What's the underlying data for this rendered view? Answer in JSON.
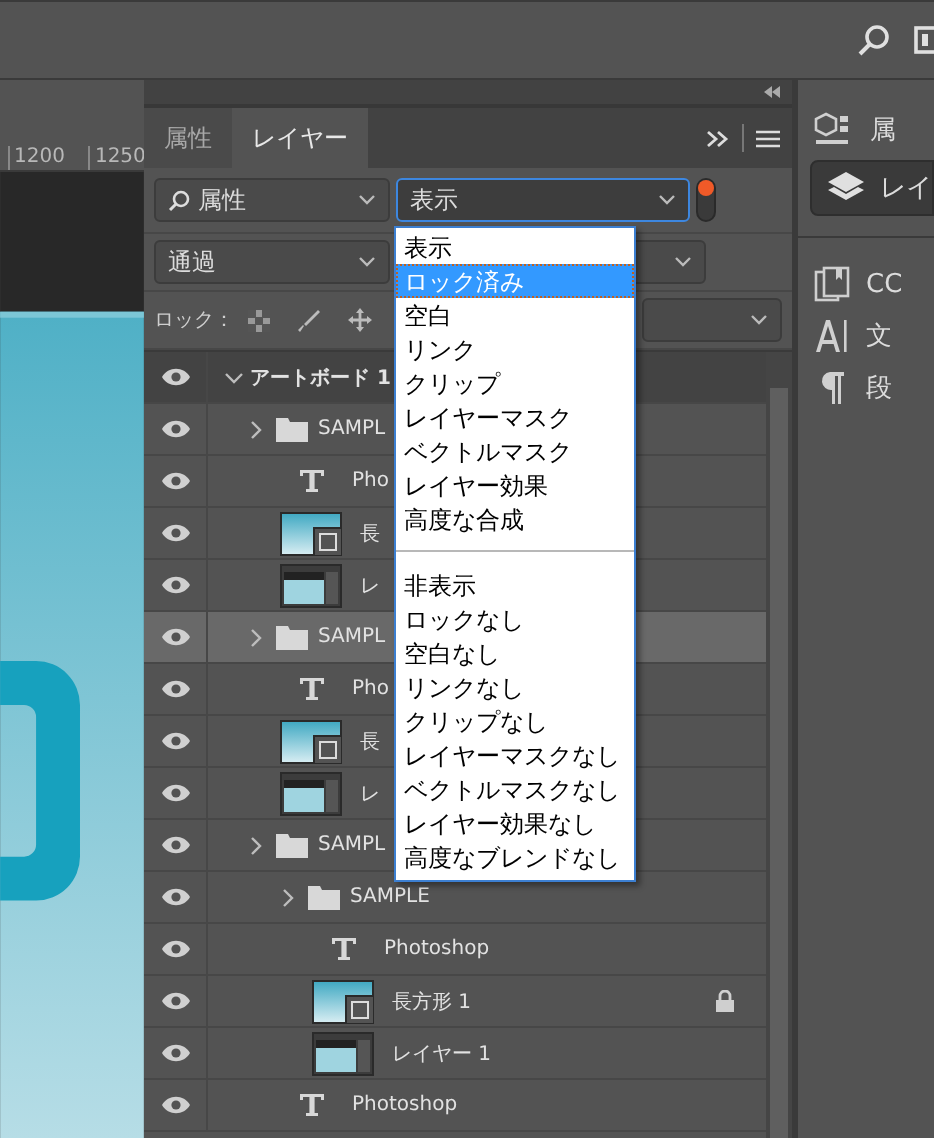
{
  "canvas": {
    "ruler_labels": [
      "1200",
      "1250"
    ]
  },
  "panel": {
    "tabs": [
      {
        "label": "属性",
        "selected": false
      },
      {
        "label": "レイヤー",
        "selected": true
      }
    ],
    "filter_type": "属性",
    "filter_value": "表示",
    "filter_on": true,
    "blend_mode": "通過",
    "lock_label": "ロック：",
    "layers": [
      {
        "kind": "artboard",
        "name": "アートボード 1",
        "expanded": true,
        "selected": false,
        "locked": false,
        "visible": true,
        "children": [
          {
            "kind": "group",
            "name": "SAMPL",
            "expanded": false,
            "selected": false,
            "locked": false,
            "visible": true,
            "children": [
              {
                "kind": "text",
                "name": "Pho",
                "selected": false,
                "locked": false,
                "visible": true
              },
              {
                "kind": "shape",
                "name": "長",
                "selected": false,
                "locked": false,
                "visible": true
              },
              {
                "kind": "pixel",
                "name": "レ",
                "selected": false,
                "locked": false,
                "visible": true
              }
            ]
          },
          {
            "kind": "group",
            "name": "SAMPL",
            "expanded": false,
            "selected": true,
            "locked": false,
            "visible": true,
            "children": [
              {
                "kind": "text",
                "name": "Pho",
                "selected": false,
                "locked": false,
                "visible": true
              },
              {
                "kind": "shape",
                "name": "長",
                "selected": false,
                "locked": false,
                "visible": true
              },
              {
                "kind": "pixel",
                "name": "レ",
                "selected": false,
                "locked": false,
                "visible": true
              }
            ]
          },
          {
            "kind": "group",
            "name": "SAMPL",
            "expanded": false,
            "selected": false,
            "locked": false,
            "visible": true,
            "children": [
              {
                "kind": "group",
                "name": "SAMPLE",
                "expanded": false,
                "selected": false,
                "locked": false,
                "visible": true,
                "children": [
                  {
                    "kind": "text",
                    "name": "Photoshop",
                    "selected": false,
                    "locked": false,
                    "visible": true
                  },
                  {
                    "kind": "shape",
                    "name": "長方形 1",
                    "selected": false,
                    "locked": true,
                    "visible": true
                  },
                  {
                    "kind": "pixel",
                    "name": "レイヤー 1",
                    "selected": false,
                    "locked": false,
                    "visible": true
                  }
                ]
              },
              {
                "kind": "text",
                "name": "Photoshop",
                "selected": false,
                "locked": false,
                "visible": true
              }
            ]
          }
        ]
      }
    ],
    "menu": [
      {
        "kind": "option",
        "label": "表示",
        "selected": false
      },
      {
        "kind": "option",
        "label": "ロック済み",
        "selected": true
      },
      {
        "kind": "option",
        "label": "空白",
        "selected": false
      },
      {
        "kind": "option",
        "label": "リンク",
        "selected": false
      },
      {
        "kind": "option",
        "label": "クリップ",
        "selected": false
      },
      {
        "kind": "option",
        "label": "レイヤーマスク",
        "selected": false
      },
      {
        "kind": "option",
        "label": "ベクトルマスク",
        "selected": false
      },
      {
        "kind": "option",
        "label": "レイヤー効果",
        "selected": false
      },
      {
        "kind": "option",
        "label": "高度な合成",
        "selected": false
      },
      {
        "kind": "separator"
      },
      {
        "kind": "option",
        "label": "非表示",
        "selected": false
      },
      {
        "kind": "option",
        "label": "ロックなし",
        "selected": false
      },
      {
        "kind": "option",
        "label": "空白なし",
        "selected": false
      },
      {
        "kind": "option",
        "label": "リンクなし",
        "selected": false
      },
      {
        "kind": "option",
        "label": "クリップなし",
        "selected": false
      },
      {
        "kind": "option",
        "label": "レイヤーマスクなし",
        "selected": false
      },
      {
        "kind": "option",
        "label": "ベクトルマスクなし",
        "selected": false
      },
      {
        "kind": "option",
        "label": "レイヤー効果なし",
        "selected": false
      },
      {
        "kind": "option",
        "label": "高度なブレンドなし",
        "selected": false
      }
    ]
  },
  "dock": {
    "items": [
      {
        "kind": "properties",
        "label": "属",
        "selected": false
      },
      {
        "kind": "layers",
        "label": "レイ",
        "selected": true
      },
      {
        "kind": "libraries",
        "label": "CC",
        "selected": false
      },
      {
        "kind": "character",
        "label": "文",
        "selected": false
      },
      {
        "kind": "paragraph",
        "label": "段",
        "selected": false
      }
    ]
  }
}
